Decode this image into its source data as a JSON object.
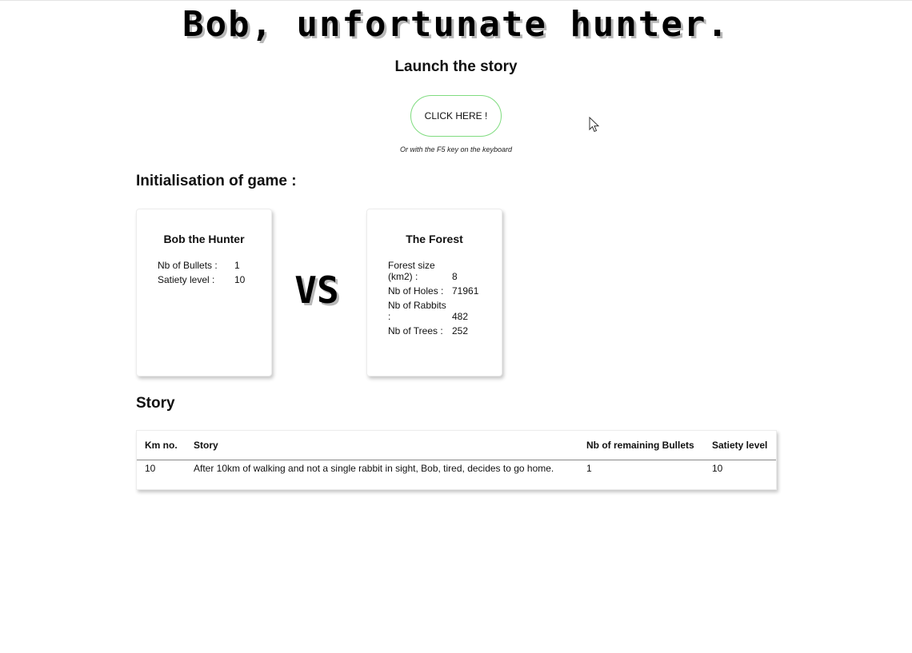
{
  "page": {
    "title": "Bob, unfortunate hunter."
  },
  "launch": {
    "heading": "Launch the story",
    "button_label": "CLICK HERE !",
    "hint": "Or with the F5 key on the keyboard"
  },
  "initialisation": {
    "heading": "Initialisation of game :",
    "versus": "VS",
    "hunter": {
      "title": "Bob the Hunter",
      "stats": [
        {
          "label": "Nb of Bullets :",
          "value": "1"
        },
        {
          "label": "Satiety level :",
          "value": "10"
        }
      ]
    },
    "forest": {
      "title": "The Forest",
      "stats": [
        {
          "label": "Forest size (km2) :",
          "value": "8"
        },
        {
          "label": "Nb of Holes :",
          "value": "71961"
        },
        {
          "label": "Nb of Rabbits :",
          "value": "482"
        },
        {
          "label": "Nb of Trees :",
          "value": "252"
        }
      ]
    }
  },
  "story": {
    "heading": "Story",
    "columns": [
      "Km no.",
      "Story",
      "Nb of remaining Bullets",
      "Satiety level"
    ],
    "rows": [
      {
        "km": "10",
        "text": "After 10km of walking and not a single rabbit in sight, Bob, tired, decides to go home.",
        "bullets": "1",
        "satiety": "10"
      }
    ]
  },
  "icons": {
    "cursor": "mouse-pointer-icon"
  }
}
